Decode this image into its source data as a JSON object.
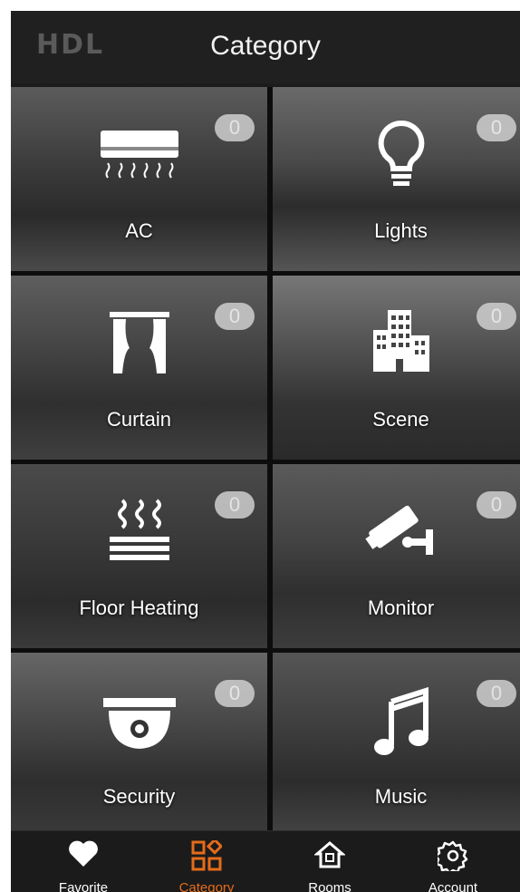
{
  "header": {
    "logo": "HDL",
    "title": "Category"
  },
  "tiles": [
    {
      "label": "AC",
      "count": "0",
      "icon": "air-conditioner-icon"
    },
    {
      "label": "Lights",
      "count": "0",
      "icon": "lightbulb-icon"
    },
    {
      "label": "Curtain",
      "count": "0",
      "icon": "curtain-icon"
    },
    {
      "label": "Scene",
      "count": "0",
      "icon": "buildings-icon"
    },
    {
      "label": "Floor Heating",
      "count": "0",
      "icon": "heating-icon"
    },
    {
      "label": "Monitor",
      "count": "0",
      "icon": "camera-icon"
    },
    {
      "label": "Security",
      "count": "0",
      "icon": "dome-camera-icon"
    },
    {
      "label": "Music",
      "count": "0",
      "icon": "music-note-icon"
    }
  ],
  "tabs": [
    {
      "label": "Favorite",
      "icon": "heart-icon"
    },
    {
      "label": "Category",
      "icon": "category-icon",
      "active": true
    },
    {
      "label": "Rooms",
      "icon": "home-icon"
    },
    {
      "label": "Account",
      "icon": "gear-icon"
    }
  ],
  "colors": {
    "accent": "#e46c1b",
    "background": "#1c1c1c"
  }
}
